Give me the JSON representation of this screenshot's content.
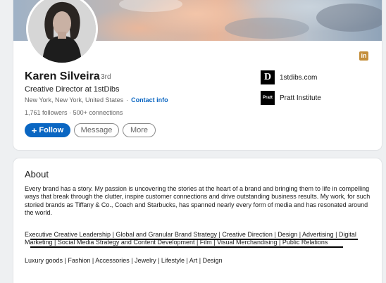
{
  "profile": {
    "name": "Karen Silveira",
    "degree": "· 3rd",
    "headline": "Creative Director at 1stDibs",
    "location": "New York, New York, United States",
    "separator": "·",
    "contact_info": "Contact info",
    "followers": "1,761 followers",
    "connections": "500+ connections",
    "stats_separator": "·",
    "badge_icon": "linkedin-icon",
    "badge_text": "in"
  },
  "actions": {
    "follow_label": "Follow",
    "follow_icon": "+",
    "message_label": "Message",
    "more_label": "More"
  },
  "companies": [
    {
      "name": "1stdibs.com",
      "logo_text": "D"
    },
    {
      "name": "Pratt Institute",
      "logo_text": "Pratt"
    }
  ],
  "about": {
    "title": "About",
    "paragraph1": "Every brand has a story. My passion is uncovering the stories at the heart of a brand and bringing them to life in compelling ways that break through the clutter, inspire customer connections and drive outstanding business results. My work, for such storied brands as Tiffany & Co., Coach and Starbucks, has spanned nearly every form of media and has resonated around the world.",
    "paragraph2": "Executive Creative Leadership | Global and Granular Brand Strategy | Creative Direction | Design | Advertising | Digital Marketing | Social Media Strategy and Content Development | Film | Visual Merchandising | Public Relations",
    "paragraph3": "Luxury goods | Fashion | Accessories | Jewelry | Lifestyle | Art | Design"
  },
  "colors": {
    "accent": "#0a66c2",
    "badge": "#c48f3c"
  }
}
